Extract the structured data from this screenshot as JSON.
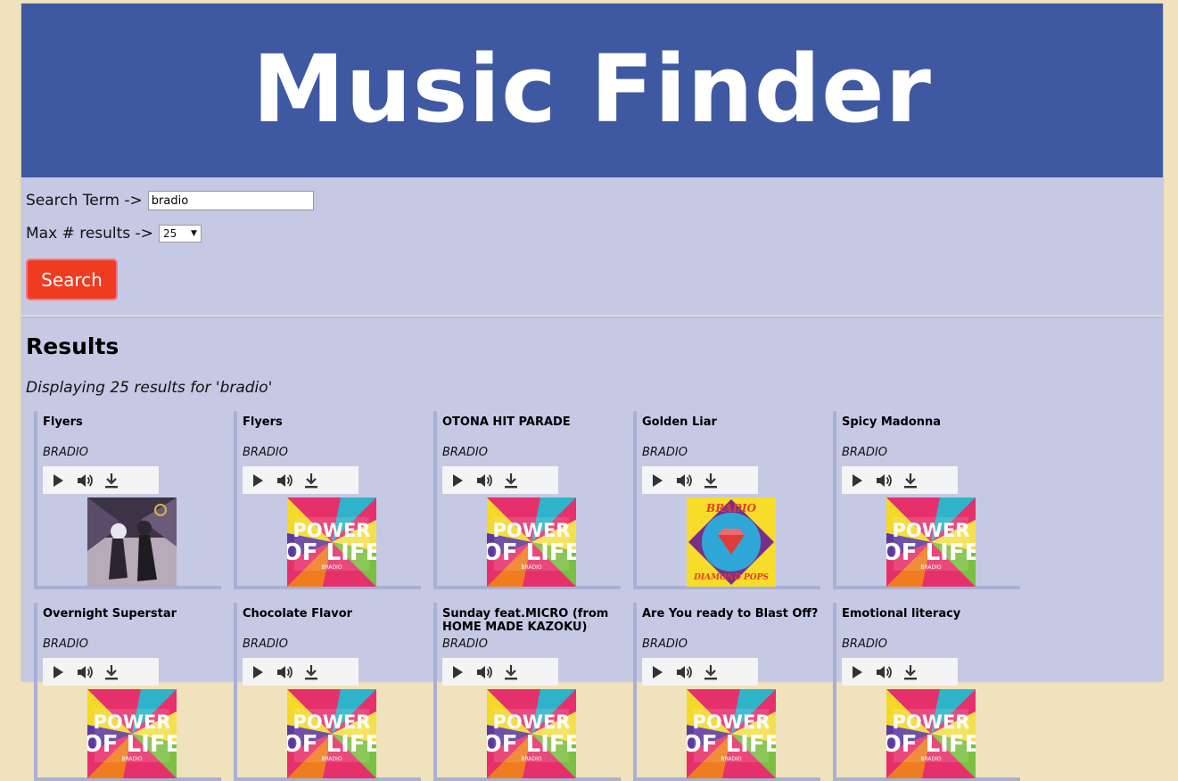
{
  "header": {
    "title": "Music Finder"
  },
  "form": {
    "term_label": "Search Term ->",
    "term_value": "bradio",
    "max_label": "Max # results ->",
    "max_value": "25",
    "search_label": "Search"
  },
  "results": {
    "heading": "Results",
    "summary": "Displaying 25 results for 'bradio'",
    "items": [
      {
        "title": "Flyers",
        "artist": "BRADIO",
        "art": "flyers-art"
      },
      {
        "title": "Flyers",
        "artist": "BRADIO",
        "art": "power-of-life-art"
      },
      {
        "title": "OTONA HIT PARADE",
        "artist": "BRADIO",
        "art": "power-of-life-art"
      },
      {
        "title": "Golden Liar",
        "artist": "BRADIO",
        "art": "diamond-pops-art"
      },
      {
        "title": "Spicy Madonna",
        "artist": "BRADIO",
        "art": "power-of-life-art"
      },
      {
        "title": "Overnight Superstar",
        "artist": "BRADIO",
        "art": "power-of-life-art"
      },
      {
        "title": "Chocolate Flavor",
        "artist": "BRADIO",
        "art": "power-of-life-art"
      },
      {
        "title": "Sunday feat.MICRO (from HOME MADE KAZOKU)",
        "artist": "BRADIO",
        "art": "power-of-life-art"
      },
      {
        "title": "Are You ready to Blast Off?",
        "artist": "BRADIO",
        "art": "power-of-life-art"
      },
      {
        "title": "Emotional literacy",
        "artist": "BRADIO",
        "art": "power-of-life-art"
      }
    ]
  },
  "colors": {
    "header": "#3f58a2",
    "panel": "#c5c9e3",
    "button": "#ef3b22",
    "page": "#f0e2bc"
  }
}
